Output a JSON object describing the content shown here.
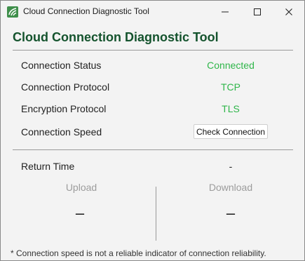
{
  "window": {
    "title": "Cloud Connection Diagnostic Tool",
    "accent_color": "#14532d",
    "icon": "app-logo-icon"
  },
  "header": {
    "heading": "Cloud Connection Diagnostic Tool"
  },
  "details": {
    "connection_status_label": "Connection Status",
    "connection_status_value": "Connected",
    "connection_protocol_label": "Connection Protocol",
    "connection_protocol_value": "TCP",
    "encryption_protocol_label": "Encryption Protocol",
    "encryption_protocol_value": "TLS",
    "connection_speed_label": "Connection Speed",
    "check_button_label": "Check Connection",
    "value_color": "#2fb64a"
  },
  "speed": {
    "return_time_label": "Return Time",
    "return_time_value": "-",
    "upload_label": "Upload",
    "upload_value": "–",
    "download_label": "Download",
    "download_value": "–"
  },
  "footnote": "* Connection speed is not a reliable indicator of connection reliability."
}
